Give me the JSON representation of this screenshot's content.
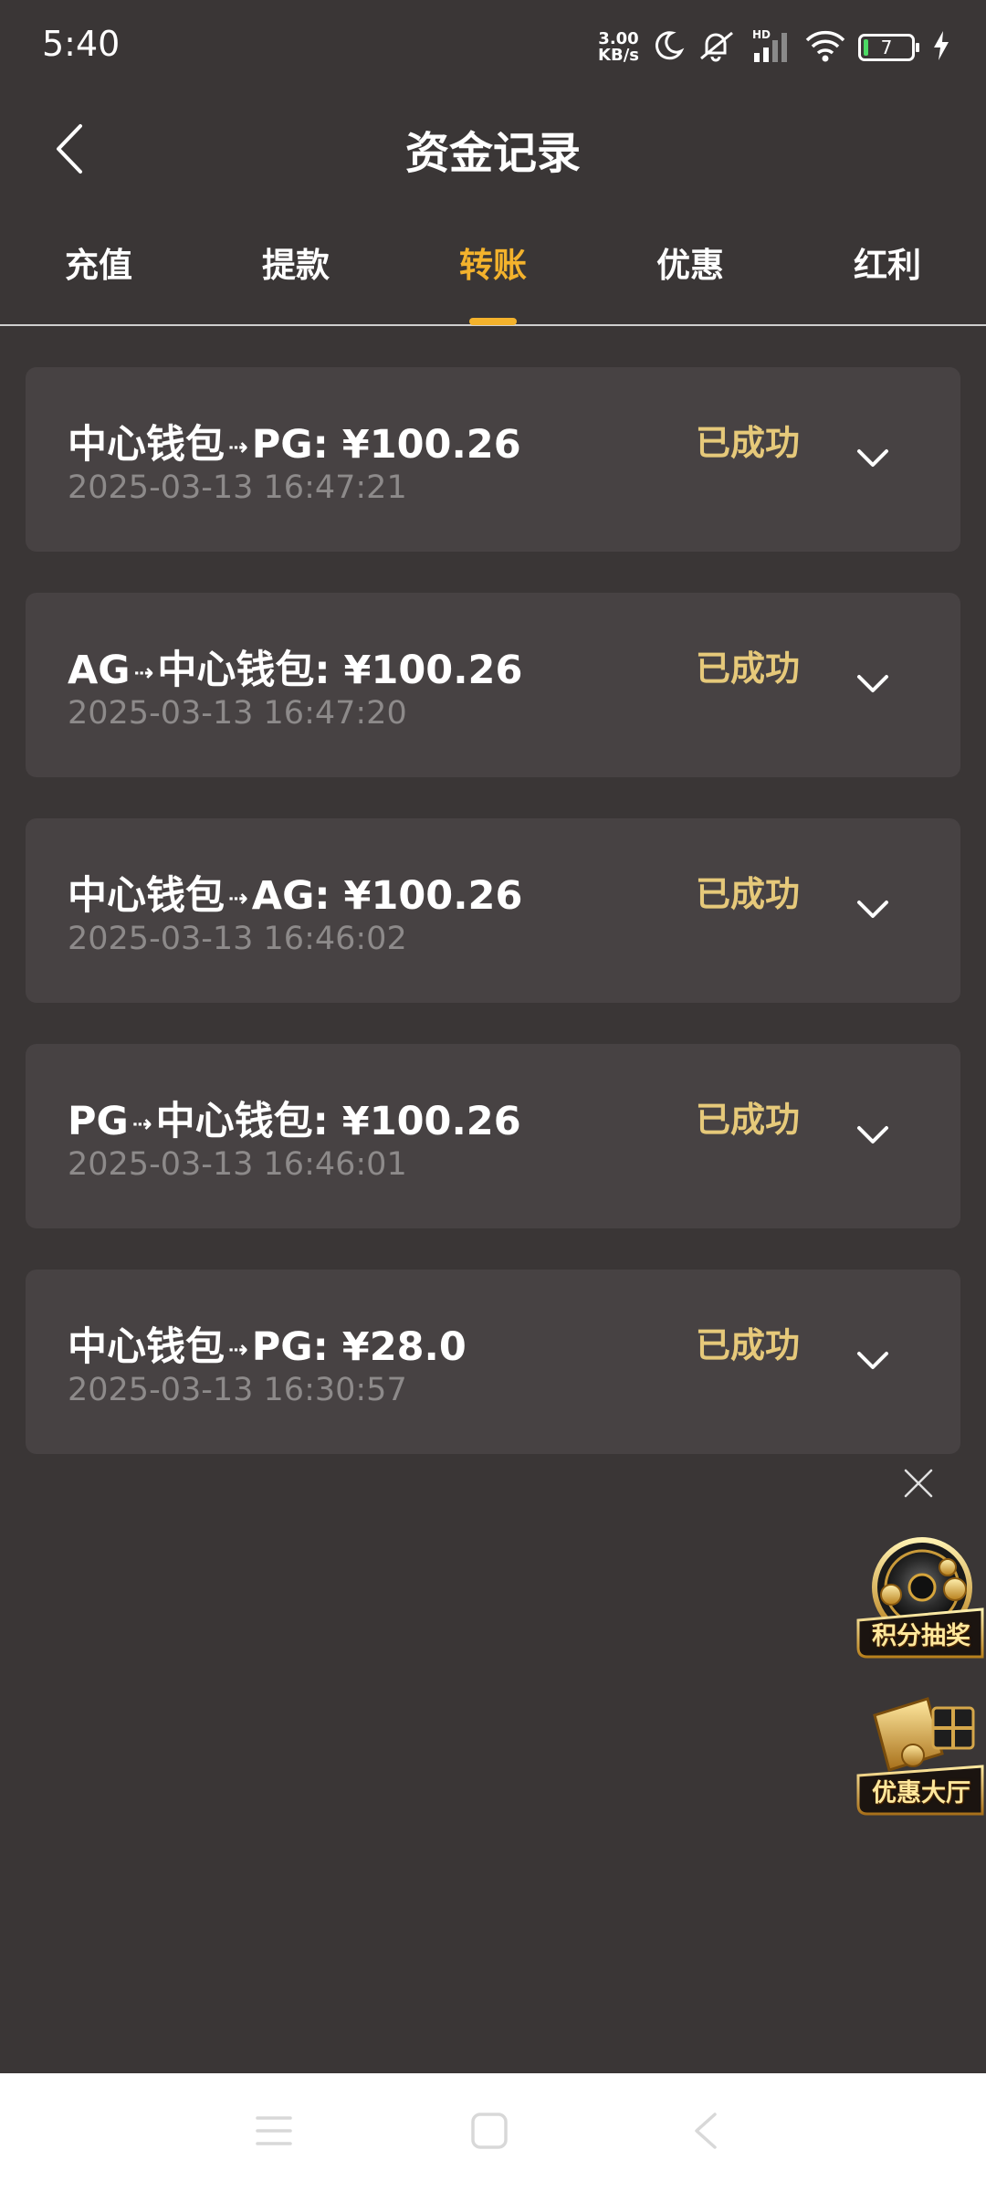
{
  "status_bar": {
    "time": "5:40",
    "net_speed_top": "3.00",
    "net_speed_bottom": "KB/s",
    "hd_label": "HD",
    "battery": "7"
  },
  "header": {
    "title": "资金记录"
  },
  "tabs": [
    {
      "label": "充值",
      "active": false
    },
    {
      "label": "提款",
      "active": false
    },
    {
      "label": "转账",
      "active": true
    },
    {
      "label": "优惠",
      "active": false
    },
    {
      "label": "红利",
      "active": false
    }
  ],
  "records": [
    {
      "from": "中心钱包",
      "to": "PG",
      "amount": "¥100.26",
      "time": "2025-03-13 16:47:21",
      "status": "已成功"
    },
    {
      "from": "AG",
      "to": "中心钱包",
      "amount": "¥100.26",
      "time": "2025-03-13 16:47:20",
      "status": "已成功"
    },
    {
      "from": "中心钱包",
      "to": "AG",
      "amount": "¥100.26",
      "time": "2025-03-13 16:46:02",
      "status": "已成功"
    },
    {
      "from": "PG",
      "to": "中心钱包",
      "amount": "¥100.26",
      "time": "2025-03-13 16:46:01",
      "status": "已成功"
    },
    {
      "from": "中心钱包",
      "to": "PG",
      "amount": "¥28.0",
      "time": "2025-03-13 16:30:57",
      "status": "已成功"
    }
  ],
  "floating": {
    "lottery_label": "积分抽奖",
    "promo_label": "优惠大厅"
  },
  "colors": {
    "background": "#3a3636",
    "card": "#474243",
    "accent": "#f3b22c",
    "status_success": "#e6c97a",
    "muted_text": "#8d8a8a"
  },
  "icons": {
    "back": "chevron-left-icon",
    "expand": "chevron-down-icon",
    "close": "close-icon",
    "nav_menu": "menu-icon",
    "nav_home": "home-icon",
    "nav_back": "back-icon"
  }
}
